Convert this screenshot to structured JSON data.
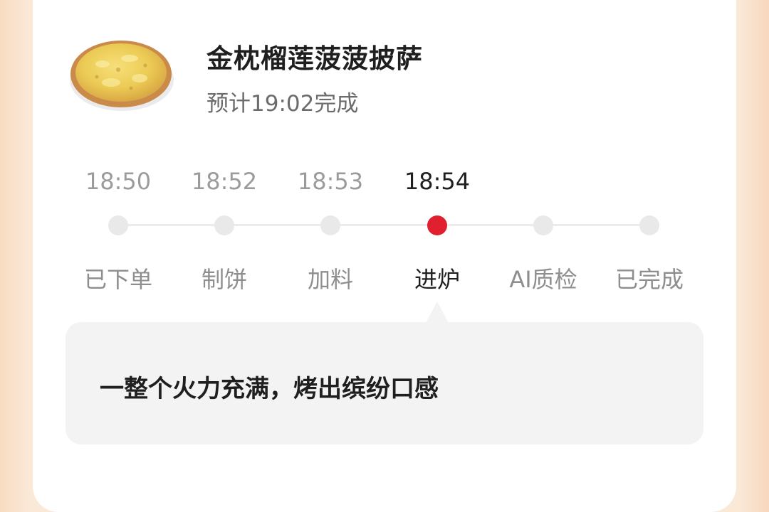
{
  "product": {
    "image_name": "durian-pizza-image",
    "title": "金枕榴莲菠菠披萨",
    "eta": "预计19:02完成"
  },
  "progress": {
    "active_index": 3,
    "steps": [
      {
        "time": "18:50",
        "label": "已下单"
      },
      {
        "time": "18:52",
        "label": "制饼"
      },
      {
        "time": "18:53",
        "label": "加料"
      },
      {
        "time": "18:54",
        "label": "进炉"
      },
      {
        "time": "",
        "label": "AI质检"
      },
      {
        "time": "",
        "label": "已完成"
      }
    ]
  },
  "tip": {
    "text": "一整个火力充满，烤出缤纷口感"
  },
  "colors": {
    "active_dot": "#e0202e",
    "inactive_dot": "#e9e9e9",
    "track": "#ececec",
    "bubble_bg": "#f3f3f3"
  }
}
